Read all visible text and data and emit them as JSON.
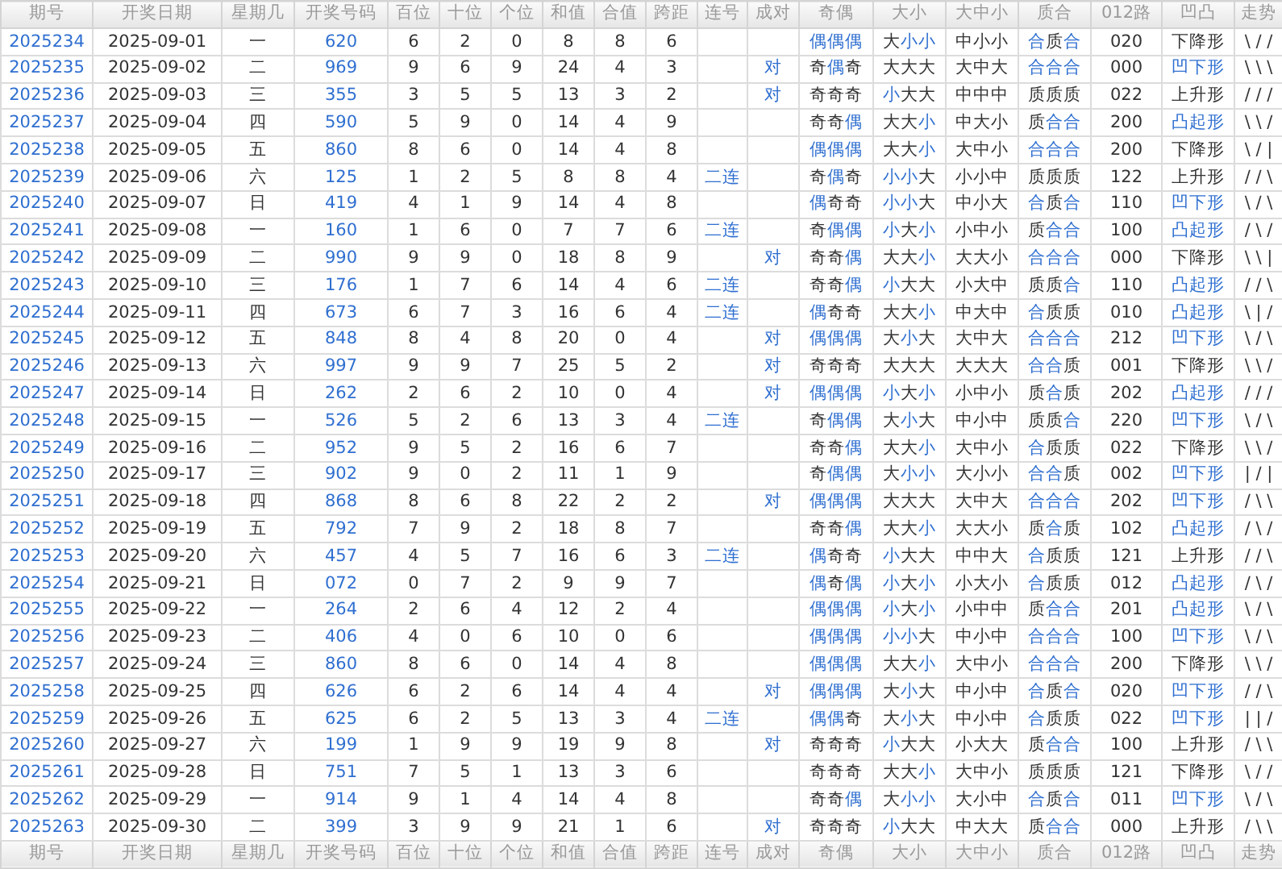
{
  "table": {
    "columns": [
      "期号",
      "开奖日期",
      "星期几",
      "开奖号码",
      "百位",
      "十位",
      "个位",
      "和值",
      "合值",
      "跨距",
      "连号",
      "成对",
      "奇偶",
      "大小",
      "大中小",
      "质合",
      "012路",
      "凹凸",
      "走势"
    ],
    "rows": [
      {
        "issue": "2025234",
        "date": "2025-09-01",
        "weekday": "一",
        "number": "620",
        "hundreds": "6",
        "tens": "2",
        "units": "0",
        "sum": "8",
        "sum_tail": "8",
        "span": "6",
        "parity": "偶偶偶",
        "parity_hl": [
          true,
          true,
          true
        ],
        "size": "大小小",
        "size_hl": [
          false,
          true,
          true
        ],
        "size3": "中小小",
        "prime": "合质合",
        "prime_hl": [
          true,
          false,
          true
        ],
        "route": "020",
        "shape": "下降形",
        "shape_hl": false,
        "trend": "\\ / /"
      },
      {
        "issue": "2025235",
        "date": "2025-09-02",
        "weekday": "二",
        "number": "969",
        "hundreds": "9",
        "tens": "6",
        "units": "9",
        "sum": "24",
        "sum_tail": "4",
        "span": "3",
        "pair": "对",
        "parity": "奇偶奇",
        "parity_hl": [
          false,
          true,
          false
        ],
        "size": "大大大",
        "size_hl": [
          false,
          false,
          false
        ],
        "size3": "大中大",
        "prime": "合合合",
        "prime_hl": [
          true,
          true,
          true
        ],
        "route": "000",
        "shape": "凹下形",
        "shape_hl": true,
        "trend": "\\ \\ \\"
      },
      {
        "issue": "2025236",
        "date": "2025-09-03",
        "weekday": "三",
        "number": "355",
        "hundreds": "3",
        "tens": "5",
        "units": "5",
        "sum": "13",
        "sum_tail": "3",
        "span": "2",
        "pair": "对",
        "parity": "奇奇奇",
        "parity_hl": [
          false,
          false,
          false
        ],
        "size": "小大大",
        "size_hl": [
          true,
          false,
          false
        ],
        "size3": "中中中",
        "prime": "质质质",
        "prime_hl": [
          false,
          false,
          false
        ],
        "route": "022",
        "shape": "上升形",
        "shape_hl": false,
        "trend": "/ / /"
      },
      {
        "issue": "2025237",
        "date": "2025-09-04",
        "weekday": "四",
        "number": "590",
        "hundreds": "5",
        "tens": "9",
        "units": "0",
        "sum": "14",
        "sum_tail": "4",
        "span": "9",
        "parity": "奇奇偶",
        "parity_hl": [
          false,
          false,
          true
        ],
        "size": "大大小",
        "size_hl": [
          false,
          false,
          true
        ],
        "size3": "中大小",
        "prime": "质合合",
        "prime_hl": [
          false,
          true,
          true
        ],
        "route": "200",
        "shape": "凸起形",
        "shape_hl": true,
        "trend": "\\ \\ /"
      },
      {
        "issue": "2025238",
        "date": "2025-09-05",
        "weekday": "五",
        "number": "860",
        "hundreds": "8",
        "tens": "6",
        "units": "0",
        "sum": "14",
        "sum_tail": "4",
        "span": "8",
        "parity": "偶偶偶",
        "parity_hl": [
          true,
          true,
          true
        ],
        "size": "大大小",
        "size_hl": [
          false,
          false,
          true
        ],
        "size3": "大中小",
        "prime": "合合合",
        "prime_hl": [
          true,
          true,
          true
        ],
        "route": "200",
        "shape": "下降形",
        "shape_hl": false,
        "trend": "\\ / |"
      },
      {
        "issue": "2025239",
        "date": "2025-09-06",
        "weekday": "六",
        "number": "125",
        "hundreds": "1",
        "tens": "2",
        "units": "5",
        "sum": "8",
        "sum_tail": "8",
        "span": "4",
        "link": "二连",
        "parity": "奇偶奇",
        "parity_hl": [
          false,
          true,
          false
        ],
        "size": "小小大",
        "size_hl": [
          true,
          true,
          false
        ],
        "size3": "小小中",
        "prime": "质质质",
        "prime_hl": [
          false,
          false,
          false
        ],
        "route": "122",
        "shape": "上升形",
        "shape_hl": false,
        "trend": "/ / \\"
      },
      {
        "issue": "2025240",
        "date": "2025-09-07",
        "weekday": "日",
        "number": "419",
        "hundreds": "4",
        "tens": "1",
        "units": "9",
        "sum": "14",
        "sum_tail": "4",
        "span": "8",
        "parity": "偶奇奇",
        "parity_hl": [
          true,
          false,
          false
        ],
        "size": "小小大",
        "size_hl": [
          true,
          true,
          false
        ],
        "size3": "中小大",
        "prime": "合质合",
        "prime_hl": [
          true,
          false,
          true
        ],
        "route": "110",
        "shape": "凹下形",
        "shape_hl": true,
        "trend": "\\ / \\"
      },
      {
        "issue": "2025241",
        "date": "2025-09-08",
        "weekday": "一",
        "number": "160",
        "hundreds": "1",
        "tens": "6",
        "units": "0",
        "sum": "7",
        "sum_tail": "7",
        "span": "6",
        "link": "二连",
        "parity": "奇偶偶",
        "parity_hl": [
          false,
          true,
          true
        ],
        "size": "小大小",
        "size_hl": [
          true,
          false,
          true
        ],
        "size3": "小中小",
        "prime": "质合合",
        "prime_hl": [
          false,
          true,
          true
        ],
        "route": "100",
        "shape": "凸起形",
        "shape_hl": true,
        "trend": "/ \\ /"
      },
      {
        "issue": "2025242",
        "date": "2025-09-09",
        "weekday": "二",
        "number": "990",
        "hundreds": "9",
        "tens": "9",
        "units": "0",
        "sum": "18",
        "sum_tail": "8",
        "span": "9",
        "pair": "对",
        "parity": "奇奇偶",
        "parity_hl": [
          false,
          false,
          true
        ],
        "size": "大大小",
        "size_hl": [
          false,
          false,
          true
        ],
        "size3": "大大小",
        "prime": "合合合",
        "prime_hl": [
          true,
          true,
          true
        ],
        "route": "000",
        "shape": "下降形",
        "shape_hl": false,
        "trend": "\\ \\ |"
      },
      {
        "issue": "2025243",
        "date": "2025-09-10",
        "weekday": "三",
        "number": "176",
        "hundreds": "1",
        "tens": "7",
        "units": "6",
        "sum": "14",
        "sum_tail": "4",
        "span": "6",
        "link": "二连",
        "parity": "奇奇偶",
        "parity_hl": [
          false,
          false,
          true
        ],
        "size": "小大大",
        "size_hl": [
          true,
          false,
          false
        ],
        "size3": "小大中",
        "prime": "质质合",
        "prime_hl": [
          false,
          false,
          true
        ],
        "route": "110",
        "shape": "凸起形",
        "shape_hl": true,
        "trend": "/ / \\"
      },
      {
        "issue": "2025244",
        "date": "2025-09-11",
        "weekday": "四",
        "number": "673",
        "hundreds": "6",
        "tens": "7",
        "units": "3",
        "sum": "16",
        "sum_tail": "6",
        "span": "4",
        "link": "二连",
        "parity": "偶奇奇",
        "parity_hl": [
          true,
          false,
          false
        ],
        "size": "大大小",
        "size_hl": [
          false,
          false,
          true
        ],
        "size3": "中大中",
        "prime": "合质质",
        "prime_hl": [
          true,
          false,
          false
        ],
        "route": "010",
        "shape": "凸起形",
        "shape_hl": true,
        "trend": "\\ | /"
      },
      {
        "issue": "2025245",
        "date": "2025-09-12",
        "weekday": "五",
        "number": "848",
        "hundreds": "8",
        "tens": "4",
        "units": "8",
        "sum": "20",
        "sum_tail": "0",
        "span": "4",
        "pair": "对",
        "parity": "偶偶偶",
        "parity_hl": [
          true,
          true,
          true
        ],
        "size": "大小大",
        "size_hl": [
          false,
          true,
          false
        ],
        "size3": "大中大",
        "prime": "合合合",
        "prime_hl": [
          true,
          true,
          true
        ],
        "route": "212",
        "shape": "凹下形",
        "shape_hl": true,
        "trend": "\\ / \\"
      },
      {
        "issue": "2025246",
        "date": "2025-09-13",
        "weekday": "六",
        "number": "997",
        "hundreds": "9",
        "tens": "9",
        "units": "7",
        "sum": "25",
        "sum_tail": "5",
        "span": "2",
        "pair": "对",
        "parity": "奇奇奇",
        "parity_hl": [
          false,
          false,
          false
        ],
        "size": "大大大",
        "size_hl": [
          false,
          false,
          false
        ],
        "size3": "大大大",
        "prime": "合合质",
        "prime_hl": [
          true,
          true,
          false
        ],
        "route": "001",
        "shape": "下降形",
        "shape_hl": false,
        "trend": "\\ \\ /"
      },
      {
        "issue": "2025247",
        "date": "2025-09-14",
        "weekday": "日",
        "number": "262",
        "hundreds": "2",
        "tens": "6",
        "units": "2",
        "sum": "10",
        "sum_tail": "0",
        "span": "4",
        "pair": "对",
        "parity": "偶偶偶",
        "parity_hl": [
          true,
          true,
          true
        ],
        "size": "小大小",
        "size_hl": [
          true,
          false,
          true
        ],
        "size3": "小中小",
        "prime": "质合质",
        "prime_hl": [
          false,
          true,
          false
        ],
        "route": "202",
        "shape": "凸起形",
        "shape_hl": true,
        "trend": "/ / /"
      },
      {
        "issue": "2025248",
        "date": "2025-09-15",
        "weekday": "一",
        "number": "526",
        "hundreds": "5",
        "tens": "2",
        "units": "6",
        "sum": "13",
        "sum_tail": "3",
        "span": "4",
        "link": "二连",
        "parity": "奇偶偶",
        "parity_hl": [
          false,
          true,
          true
        ],
        "size": "大小大",
        "size_hl": [
          false,
          true,
          false
        ],
        "size3": "中小中",
        "prime": "质质合",
        "prime_hl": [
          false,
          false,
          true
        ],
        "route": "220",
        "shape": "凹下形",
        "shape_hl": true,
        "trend": "\\ / \\"
      },
      {
        "issue": "2025249",
        "date": "2025-09-16",
        "weekday": "二",
        "number": "952",
        "hundreds": "9",
        "tens": "5",
        "units": "2",
        "sum": "16",
        "sum_tail": "6",
        "span": "7",
        "parity": "奇奇偶",
        "parity_hl": [
          false,
          false,
          true
        ],
        "size": "大大小",
        "size_hl": [
          false,
          false,
          true
        ],
        "size3": "大中小",
        "prime": "合质质",
        "prime_hl": [
          true,
          false,
          false
        ],
        "route": "022",
        "shape": "下降形",
        "shape_hl": false,
        "trend": "\\ \\ /"
      },
      {
        "issue": "2025250",
        "date": "2025-09-17",
        "weekday": "三",
        "number": "902",
        "hundreds": "9",
        "tens": "0",
        "units": "2",
        "sum": "11",
        "sum_tail": "1",
        "span": "9",
        "parity": "奇偶偶",
        "parity_hl": [
          false,
          true,
          true
        ],
        "size": "大小小",
        "size_hl": [
          false,
          true,
          true
        ],
        "size3": "大小小",
        "prime": "合合质",
        "prime_hl": [
          true,
          true,
          false
        ],
        "route": "002",
        "shape": "凹下形",
        "shape_hl": true,
        "trend": "| / |"
      },
      {
        "issue": "2025251",
        "date": "2025-09-18",
        "weekday": "四",
        "number": "868",
        "hundreds": "8",
        "tens": "6",
        "units": "8",
        "sum": "22",
        "sum_tail": "2",
        "span": "2",
        "pair": "对",
        "parity": "偶偶偶",
        "parity_hl": [
          true,
          true,
          true
        ],
        "size": "大大大",
        "size_hl": [
          false,
          false,
          false
        ],
        "size3": "大中大",
        "prime": "合合合",
        "prime_hl": [
          true,
          true,
          true
        ],
        "route": "202",
        "shape": "凹下形",
        "shape_hl": true,
        "trend": "/ \\ \\"
      },
      {
        "issue": "2025252",
        "date": "2025-09-19",
        "weekday": "五",
        "number": "792",
        "hundreds": "7",
        "tens": "9",
        "units": "2",
        "sum": "18",
        "sum_tail": "8",
        "span": "7",
        "parity": "奇奇偶",
        "parity_hl": [
          false,
          false,
          true
        ],
        "size": "大大小",
        "size_hl": [
          false,
          false,
          true
        ],
        "size3": "大大小",
        "prime": "质合质",
        "prime_hl": [
          false,
          true,
          false
        ],
        "route": "102",
        "shape": "凸起形",
        "shape_hl": true,
        "trend": "/ \\ /"
      },
      {
        "issue": "2025253",
        "date": "2025-09-20",
        "weekday": "六",
        "number": "457",
        "hundreds": "4",
        "tens": "5",
        "units": "7",
        "sum": "16",
        "sum_tail": "6",
        "span": "3",
        "link": "二连",
        "parity": "偶奇奇",
        "parity_hl": [
          true,
          false,
          false
        ],
        "size": "小大大",
        "size_hl": [
          true,
          false,
          false
        ],
        "size3": "中中大",
        "prime": "合质质",
        "prime_hl": [
          true,
          false,
          false
        ],
        "route": "121",
        "shape": "上升形",
        "shape_hl": false,
        "trend": "/ / \\"
      },
      {
        "issue": "2025254",
        "date": "2025-09-21",
        "weekday": "日",
        "number": "072",
        "hundreds": "0",
        "tens": "7",
        "units": "2",
        "sum": "9",
        "sum_tail": "9",
        "span": "7",
        "parity": "偶奇偶",
        "parity_hl": [
          true,
          false,
          true
        ],
        "size": "小大小",
        "size_hl": [
          true,
          false,
          true
        ],
        "size3": "小大小",
        "prime": "合质质",
        "prime_hl": [
          true,
          false,
          false
        ],
        "route": "012",
        "shape": "凸起形",
        "shape_hl": true,
        "trend": "/ \\ /"
      },
      {
        "issue": "2025255",
        "date": "2025-09-22",
        "weekday": "一",
        "number": "264",
        "hundreds": "2",
        "tens": "6",
        "units": "4",
        "sum": "12",
        "sum_tail": "2",
        "span": "4",
        "parity": "偶偶偶",
        "parity_hl": [
          true,
          true,
          true
        ],
        "size": "小大小",
        "size_hl": [
          true,
          false,
          true
        ],
        "size3": "小中中",
        "prime": "质合合",
        "prime_hl": [
          false,
          true,
          true
        ],
        "route": "201",
        "shape": "凸起形",
        "shape_hl": true,
        "trend": "\\ / \\"
      },
      {
        "issue": "2025256",
        "date": "2025-09-23",
        "weekday": "二",
        "number": "406",
        "hundreds": "4",
        "tens": "0",
        "units": "6",
        "sum": "10",
        "sum_tail": "0",
        "span": "6",
        "parity": "偶偶偶",
        "parity_hl": [
          true,
          true,
          true
        ],
        "size": "小小大",
        "size_hl": [
          true,
          true,
          false
        ],
        "size3": "中小中",
        "prime": "合合合",
        "prime_hl": [
          true,
          true,
          true
        ],
        "route": "100",
        "shape": "凹下形",
        "shape_hl": true,
        "trend": "\\ / \\"
      },
      {
        "issue": "2025257",
        "date": "2025-09-24",
        "weekday": "三",
        "number": "860",
        "hundreds": "8",
        "tens": "6",
        "units": "0",
        "sum": "14",
        "sum_tail": "4",
        "span": "8",
        "parity": "偶偶偶",
        "parity_hl": [
          true,
          true,
          true
        ],
        "size": "大大小",
        "size_hl": [
          false,
          false,
          true
        ],
        "size3": "大中小",
        "prime": "合合合",
        "prime_hl": [
          true,
          true,
          true
        ],
        "route": "200",
        "shape": "下降形",
        "shape_hl": false,
        "trend": "\\ \\ /"
      },
      {
        "issue": "2025258",
        "date": "2025-09-25",
        "weekday": "四",
        "number": "626",
        "hundreds": "6",
        "tens": "2",
        "units": "6",
        "sum": "14",
        "sum_tail": "4",
        "span": "4",
        "pair": "对",
        "parity": "偶偶偶",
        "parity_hl": [
          true,
          true,
          true
        ],
        "size": "大小大",
        "size_hl": [
          false,
          true,
          false
        ],
        "size3": "中小中",
        "prime": "合质合",
        "prime_hl": [
          true,
          false,
          true
        ],
        "route": "020",
        "shape": "凹下形",
        "shape_hl": true,
        "trend": "/ / \\"
      },
      {
        "issue": "2025259",
        "date": "2025-09-26",
        "weekday": "五",
        "number": "625",
        "hundreds": "6",
        "tens": "2",
        "units": "5",
        "sum": "13",
        "sum_tail": "3",
        "span": "4",
        "link": "二连",
        "parity": "偶偶奇",
        "parity_hl": [
          true,
          true,
          false
        ],
        "size": "大小大",
        "size_hl": [
          false,
          true,
          false
        ],
        "size3": "中小中",
        "prime": "合质质",
        "prime_hl": [
          true,
          false,
          false
        ],
        "route": "022",
        "shape": "凹下形",
        "shape_hl": true,
        "trend": "| | /"
      },
      {
        "issue": "2025260",
        "date": "2025-09-27",
        "weekday": "六",
        "number": "199",
        "hundreds": "1",
        "tens": "9",
        "units": "9",
        "sum": "19",
        "sum_tail": "9",
        "span": "8",
        "pair": "对",
        "parity": "奇奇奇",
        "parity_hl": [
          false,
          false,
          false
        ],
        "size": "小大大",
        "size_hl": [
          true,
          false,
          false
        ],
        "size3": "小大大",
        "prime": "质合合",
        "prime_hl": [
          false,
          true,
          true
        ],
        "route": "100",
        "shape": "上升形",
        "shape_hl": false,
        "trend": "/ \\ \\"
      },
      {
        "issue": "2025261",
        "date": "2025-09-28",
        "weekday": "日",
        "number": "751",
        "hundreds": "7",
        "tens": "5",
        "units": "1",
        "sum": "13",
        "sum_tail": "3",
        "span": "6",
        "parity": "奇奇奇",
        "parity_hl": [
          false,
          false,
          false
        ],
        "size": "大大小",
        "size_hl": [
          false,
          false,
          true
        ],
        "size3": "大中小",
        "prime": "质质质",
        "prime_hl": [
          false,
          false,
          false
        ],
        "route": "121",
        "shape": "下降形",
        "shape_hl": false,
        "trend": "\\ / /"
      },
      {
        "issue": "2025262",
        "date": "2025-09-29",
        "weekday": "一",
        "number": "914",
        "hundreds": "9",
        "tens": "1",
        "units": "4",
        "sum": "14",
        "sum_tail": "4",
        "span": "8",
        "parity": "奇奇偶",
        "parity_hl": [
          false,
          false,
          true
        ],
        "size": "大小小",
        "size_hl": [
          false,
          true,
          true
        ],
        "size3": "大小中",
        "prime": "合质合",
        "prime_hl": [
          true,
          false,
          true
        ],
        "route": "011",
        "shape": "凹下形",
        "shape_hl": true,
        "trend": "\\ / \\"
      },
      {
        "issue": "2025263",
        "date": "2025-09-30",
        "weekday": "二",
        "number": "399",
        "hundreds": "3",
        "tens": "9",
        "units": "9",
        "sum": "21",
        "sum_tail": "1",
        "span": "6",
        "pair": "对",
        "parity": "奇奇奇",
        "parity_hl": [
          false,
          false,
          false
        ],
        "size": "小大大",
        "size_hl": [
          true,
          false,
          false
        ],
        "size3": "中大大",
        "prime": "质合合",
        "prime_hl": [
          false,
          true,
          true
        ],
        "route": "000",
        "shape": "上升形",
        "shape_hl": false,
        "trend": "/ \\ \\"
      }
    ],
    "footer": [
      "期号",
      "开奖日期",
      "星期几",
      "开奖号码",
      "百位",
      "十位",
      "个位",
      "和值",
      "合值",
      "跨距",
      "连号",
      "成对",
      "奇偶",
      "大小",
      "大中小",
      "质合",
      "012路",
      "凹凸",
      "走势"
    ]
  }
}
